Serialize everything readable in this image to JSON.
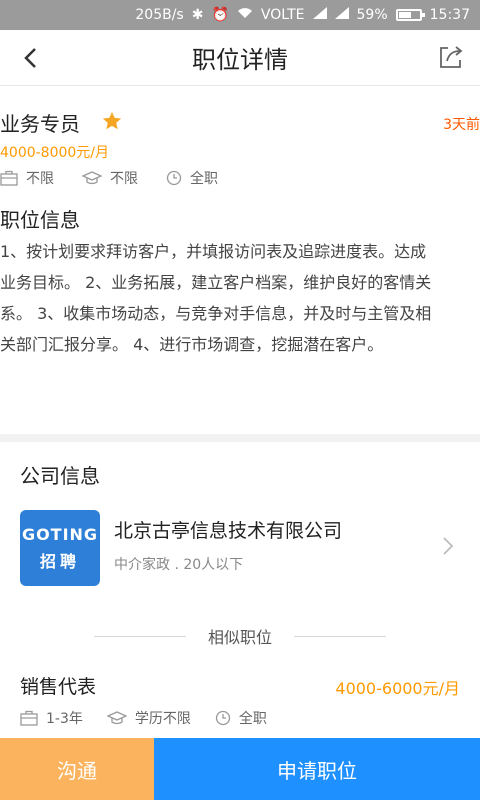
{
  "status_bar": {
    "speed": "205B/s",
    "network": "VOLTE",
    "battery": "59%",
    "time": "15:37",
    "battery_level": 0.59
  },
  "header": {
    "title": "职位详情",
    "back_icon": "chevron-left-icon",
    "share_icon": "share-icon"
  },
  "job": {
    "title": "业务专员",
    "posted": "3天前",
    "salary": "4000-8000元/月",
    "tags": [
      {
        "icon": "briefcase-icon",
        "text": "不限"
      },
      {
        "icon": "graduation-cap-icon",
        "text": "不限"
      },
      {
        "icon": "clock-icon",
        "text": "全职"
      }
    ],
    "info_title": "职位信息",
    "description": "1、按计划要求拜访客户，并填报访问表及追踪进度表。达成业务目标。 2、业务拓展，建立客户档案，维护良好的客情关系。 3、收集市场动态，与竞争对手信息，并及时与主管及相关部门汇报分享。 4、进行市场调查，挖掘潜在客户。"
  },
  "company": {
    "section_title": "公司信息",
    "logo_line1": "GOTING",
    "logo_line2": "招聘",
    "name": "北京古亭信息技术有限公司",
    "meta": "中介家政 . 20人以下"
  },
  "similar": {
    "section_title": "相似职位",
    "job": {
      "title": "销售代表",
      "salary": "4000-6000元/月",
      "tags": [
        {
          "icon": "briefcase-icon",
          "text": "1-3年"
        },
        {
          "icon": "graduation-cap-icon",
          "text": "学历不限"
        },
        {
          "icon": "clock-icon",
          "text": "全职"
        }
      ]
    }
  },
  "actions": {
    "chat": "沟通",
    "apply": "申请职位"
  },
  "colors": {
    "accent_orange": "#ff9a00",
    "time_red": "#ff5a00",
    "apply_blue": "#1e90ff",
    "chat_orange": "#fbb35d",
    "star": "#f5a623"
  }
}
